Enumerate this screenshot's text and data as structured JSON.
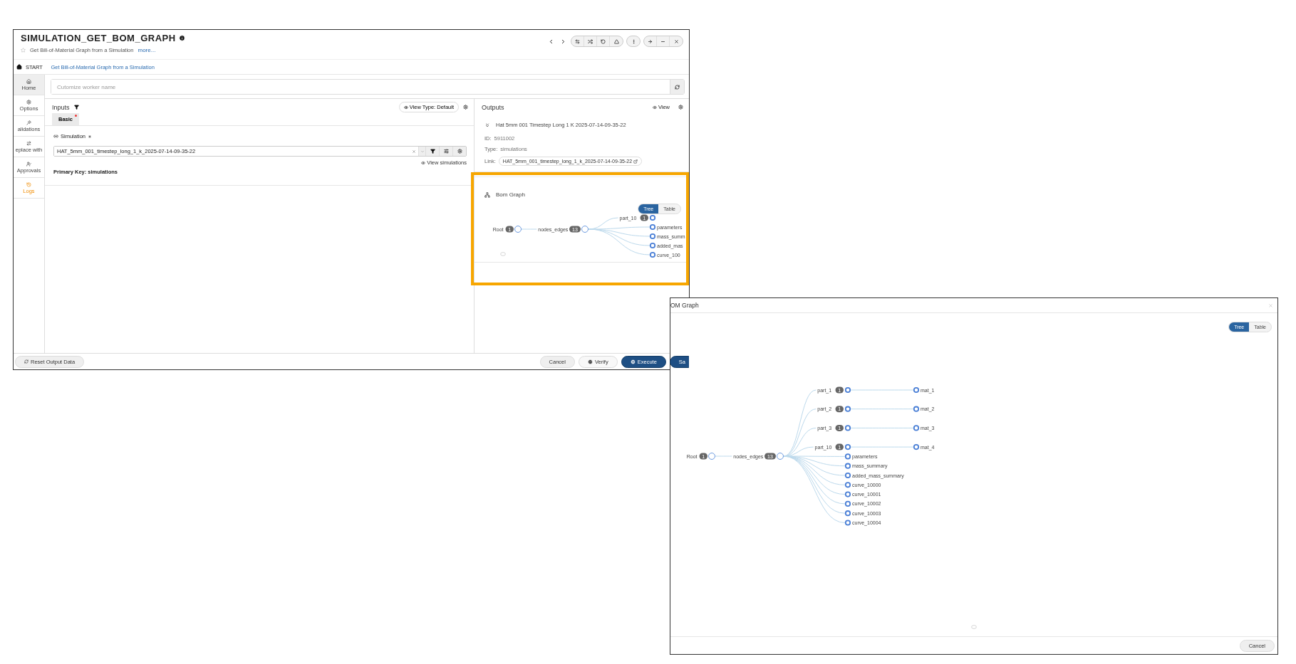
{
  "main_window": {
    "title": "SIMULATION_GET_BOM_GRAPH",
    "subtitle": "Get Bill-of-Material Graph from a Simulation",
    "more_link": "more...",
    "breadcrumb": [
      {
        "label": "START",
        "selected": false
      },
      {
        "label": "Get Bill-of-Material Graph from a Simulation",
        "selected": true
      }
    ],
    "sidebar": [
      {
        "label": "Home",
        "selected": true,
        "accent": false
      },
      {
        "label": "Options",
        "selected": false,
        "accent": false
      },
      {
        "label": "alidations",
        "selected": false,
        "accent": false
      },
      {
        "label": "eplace with",
        "selected": false,
        "accent": false
      },
      {
        "label": "Approvals",
        "selected": false,
        "accent": false
      },
      {
        "label": "Logs",
        "selected": false,
        "accent": true
      }
    ],
    "worker_name": {
      "placeholder": "Cutomize worker name"
    },
    "inputs": {
      "title": "Inputs",
      "view_type": "View Type: Default",
      "tabs": [
        {
          "label": "Basic",
          "selected": true,
          "required": true
        }
      ],
      "field": {
        "label": "Simulation",
        "required": true,
        "value": "HAT_5mm_001_timestep_long_1_k_2025-07-14-09-35-22"
      },
      "view_link": "View simulations",
      "primary_key": "Primary Key: simulations"
    },
    "outputs": {
      "title": "Outputs",
      "view": "View",
      "record": {
        "name": "Hat 5mm 001 Timestep Long 1 K 2025-07-14-09-35-22",
        "id_label": "ID:",
        "id": "5911002",
        "type_label": "Type:",
        "type": "simulations",
        "link_label": "Link:",
        "link": "HAT_5mm_001_timestep_long_1_k_2025-07-14-09-35-22"
      },
      "graph": {
        "title": "Bom Graph",
        "toggle": [
          {
            "label": "Tree",
            "selected": true
          },
          {
            "label": "Table",
            "selected": false
          }
        ],
        "tree": {
          "label": "Root",
          "badge": "1",
          "children": [
            {
              "label": "nodes_edges",
              "badge": "13",
              "children": [
                {
                  "label": "part_10",
                  "badge": "1"
                },
                {
                  "label": "parameters"
                },
                {
                  "label": "mass_summ"
                },
                {
                  "label": "added_mas"
                },
                {
                  "label": "curve_100"
                }
              ]
            }
          ]
        }
      }
    },
    "highlight": {
      "on": true
    },
    "footer": {
      "reset": "Reset Output Data",
      "buttons": [
        {
          "label": "Cancel",
          "kind": "plain"
        },
        {
          "label": "Verify",
          "kind": "verify"
        },
        {
          "label": "Execute",
          "kind": "primary"
        },
        {
          "label": "Sa",
          "kind": "primary"
        }
      ]
    }
  },
  "modal": {
    "title": "OM Graph",
    "toggle": [
      {
        "label": "Tree",
        "selected": true
      },
      {
        "label": "Table",
        "selected": false
      }
    ],
    "tree": {
      "label": "Root",
      "badge": "1",
      "children": [
        {
          "label": "nodes_edges",
          "badge": "13",
          "children": [
            {
              "label": "part_1",
              "badge": "1",
              "children": [
                {
                  "label": "mat_1"
                }
              ]
            },
            {
              "label": "part_2",
              "badge": "1",
              "children": [
                {
                  "label": "mat_2"
                }
              ]
            },
            {
              "label": "part_3",
              "badge": "1",
              "children": [
                {
                  "label": "mat_3"
                }
              ]
            },
            {
              "label": "part_10",
              "badge": "1",
              "children": [
                {
                  "label": "mat_4"
                }
              ]
            },
            {
              "label": "parameters"
            },
            {
              "label": "mass_summary"
            },
            {
              "label": "added_mass_summary"
            },
            {
              "label": "curve_10000"
            },
            {
              "label": "curve_10001"
            },
            {
              "label": "curve_10002"
            },
            {
              "label": "curve_10003"
            },
            {
              "label": "curve_10004"
            }
          ]
        }
      ]
    },
    "buttons": [
      {
        "label": "Cancel",
        "kind": "plain"
      }
    ]
  }
}
